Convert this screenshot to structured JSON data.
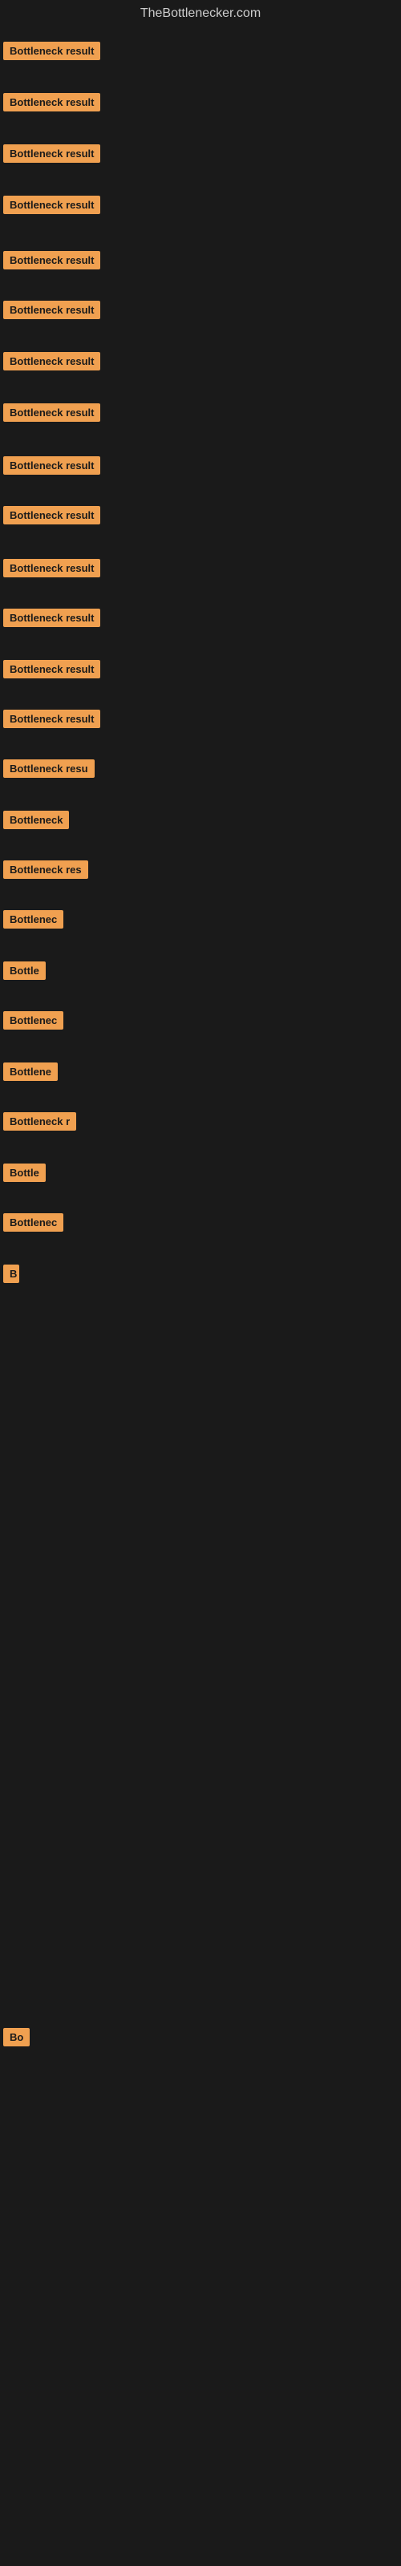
{
  "site": {
    "title": "TheBottlenecker.com"
  },
  "rows": [
    {
      "id": 1,
      "label": "Bottleneck result",
      "rowClass": "row-1",
      "widthClass": "w-full"
    },
    {
      "id": 2,
      "label": "Bottleneck result",
      "rowClass": "row-2",
      "widthClass": "w-full"
    },
    {
      "id": 3,
      "label": "Bottleneck result",
      "rowClass": "row-3",
      "widthClass": "w-full"
    },
    {
      "id": 4,
      "label": "Bottleneck result",
      "rowClass": "row-4",
      "widthClass": "w-full"
    },
    {
      "id": 5,
      "label": "Bottleneck result",
      "rowClass": "row-5",
      "widthClass": "w-full"
    },
    {
      "id": 6,
      "label": "Bottleneck result",
      "rowClass": "row-6",
      "widthClass": "w-full"
    },
    {
      "id": 7,
      "label": "Bottleneck result",
      "rowClass": "row-7",
      "widthClass": "w-full"
    },
    {
      "id": 8,
      "label": "Bottleneck result",
      "rowClass": "row-8",
      "widthClass": "w-full"
    },
    {
      "id": 9,
      "label": "Bottleneck result",
      "rowClass": "row-9",
      "widthClass": "w-full"
    },
    {
      "id": 10,
      "label": "Bottleneck result",
      "rowClass": "row-10",
      "widthClass": "w-full"
    },
    {
      "id": 11,
      "label": "Bottleneck result",
      "rowClass": "row-11",
      "widthClass": "w-full"
    },
    {
      "id": 12,
      "label": "Bottleneck result",
      "rowClass": "row-12",
      "widthClass": "w-full"
    },
    {
      "id": 13,
      "label": "Bottleneck result",
      "rowClass": "row-13",
      "widthClass": "w-full"
    },
    {
      "id": 14,
      "label": "Bottleneck result",
      "rowClass": "row-14",
      "widthClass": "w-full"
    },
    {
      "id": 15,
      "label": "Bottleneck resu",
      "rowClass": "row-15",
      "widthClass": "w-large"
    },
    {
      "id": 16,
      "label": "Bottleneck",
      "rowClass": "row-16",
      "widthClass": "w-medium"
    },
    {
      "id": 17,
      "label": "Bottleneck res",
      "rowClass": "row-17",
      "widthClass": "w-large"
    },
    {
      "id": 18,
      "label": "Bottlenec",
      "rowClass": "row-18",
      "widthClass": "w-medium"
    },
    {
      "id": 19,
      "label": "Bottle",
      "rowClass": "row-19",
      "widthClass": "w-small"
    },
    {
      "id": 20,
      "label": "Bottlenec",
      "rowClass": "row-20",
      "widthClass": "w-medium"
    },
    {
      "id": 21,
      "label": "Bottlene",
      "rowClass": "row-21",
      "widthClass": "w-small"
    },
    {
      "id": 22,
      "label": "Bottleneck r",
      "rowClass": "row-22",
      "widthClass": "w-large"
    },
    {
      "id": 23,
      "label": "Bottle",
      "rowClass": "row-23",
      "widthClass": "w-small"
    },
    {
      "id": 24,
      "label": "Bottlenec",
      "rowClass": "row-24",
      "widthClass": "w-medium"
    },
    {
      "id": 25,
      "label": "B",
      "rowClass": "row-25",
      "widthClass": "w-micro"
    },
    {
      "id": 26,
      "label": "",
      "rowClass": "row-26",
      "widthClass": "w-micro"
    },
    {
      "id": 27,
      "label": "",
      "rowClass": "row-27",
      "widthClass": "w-micro"
    },
    {
      "id": 28,
      "label": "",
      "rowClass": "row-28",
      "widthClass": "w-micro"
    },
    {
      "id": 29,
      "label": "Bo",
      "rowClass": "row-29",
      "widthClass": "w-tiny"
    }
  ]
}
